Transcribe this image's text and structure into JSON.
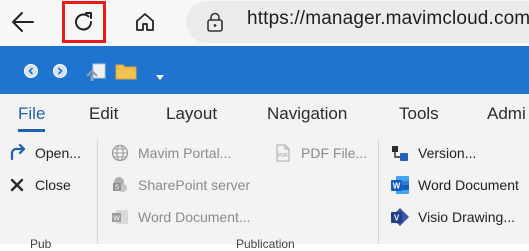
{
  "browser": {
    "url": "https://manager.mavimcloud.com"
  },
  "ribbon": {
    "tabs": [
      "File",
      "Edit",
      "Layout",
      "Navigation",
      "Tools",
      "Admi"
    ],
    "active_tab": "File",
    "commands": {
      "open": "Open...",
      "close": "Close",
      "mavim_portal": "Mavim Portal...",
      "sharepoint_server": "SharePoint server",
      "word_document_export": "Word Document...",
      "pdf_file": "PDF File...",
      "version": "Version...",
      "word_document": "Word Document",
      "visio_drawing": "Visio Drawing..."
    },
    "group_labels": {
      "first": "Pub",
      "second": "Publication"
    }
  },
  "colors": {
    "app_bar": "#1f74cf",
    "highlight": "#e81a1a",
    "active_tab": "#1f5fb5"
  }
}
